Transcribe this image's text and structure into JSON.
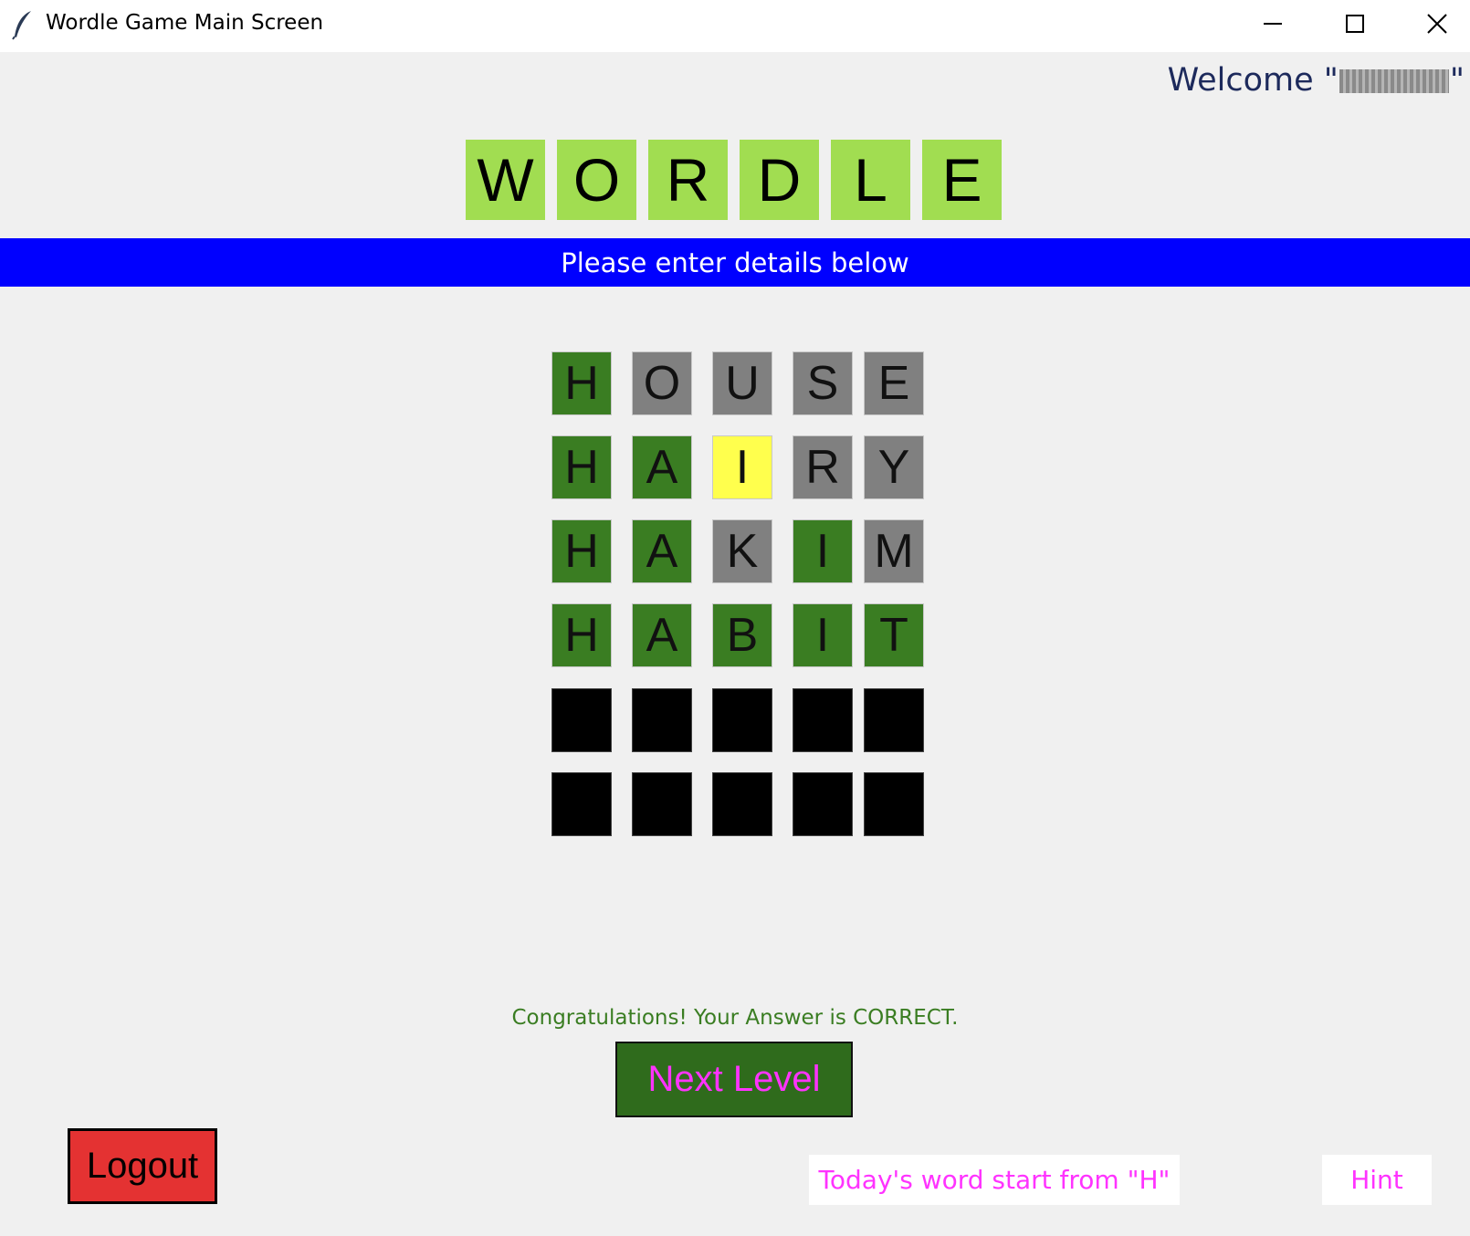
{
  "window": {
    "title": "Wordle Game Main Screen",
    "controls": [
      "minimize",
      "maximize",
      "close"
    ]
  },
  "welcome": {
    "prefix": "Welcome \"",
    "suffix": "\""
  },
  "logo": {
    "letters": [
      "W",
      "O",
      "R",
      "D",
      "L",
      "E"
    ],
    "tile_color": "#a1dd51"
  },
  "banner": {
    "text": "Please enter details below",
    "color": "#0000ff"
  },
  "grid": {
    "rows": [
      [
        {
          "l": "H",
          "s": "green"
        },
        {
          "l": "O",
          "s": "gray"
        },
        {
          "l": "U",
          "s": "gray"
        },
        {
          "l": "S",
          "s": "gray"
        },
        {
          "l": "E",
          "s": "gray"
        }
      ],
      [
        {
          "l": "H",
          "s": "green"
        },
        {
          "l": "A",
          "s": "green"
        },
        {
          "l": "I",
          "s": "yellow"
        },
        {
          "l": "R",
          "s": "gray"
        },
        {
          "l": "Y",
          "s": "gray"
        }
      ],
      [
        {
          "l": "H",
          "s": "green"
        },
        {
          "l": "A",
          "s": "green"
        },
        {
          "l": "K",
          "s": "gray"
        },
        {
          "l": "I",
          "s": "green"
        },
        {
          "l": "M",
          "s": "gray"
        }
      ],
      [
        {
          "l": "H",
          "s": "green"
        },
        {
          "l": "A",
          "s": "green"
        },
        {
          "l": "B",
          "s": "green"
        },
        {
          "l": "I",
          "s": "green"
        },
        {
          "l": "T",
          "s": "green"
        }
      ],
      [
        {
          "l": "",
          "s": "empty"
        },
        {
          "l": "",
          "s": "empty"
        },
        {
          "l": "",
          "s": "empty"
        },
        {
          "l": "",
          "s": "empty"
        },
        {
          "l": "",
          "s": "empty"
        }
      ],
      [
        {
          "l": "",
          "s": "empty"
        },
        {
          "l": "",
          "s": "empty"
        },
        {
          "l": "",
          "s": "empty"
        },
        {
          "l": "",
          "s": "empty"
        },
        {
          "l": "",
          "s": "empty"
        }
      ]
    ],
    "colors": {
      "green": "#3a7d22",
      "gray": "#808080",
      "yellow": "#ffff4d",
      "empty": "#000000"
    }
  },
  "status": {
    "message": "Congratulations! Your Answer is CORRECT."
  },
  "buttons": {
    "next_level": "Next Level",
    "logout": "Logout",
    "hint": "Hint"
  },
  "hint_text": "Today's word start from \"H\""
}
